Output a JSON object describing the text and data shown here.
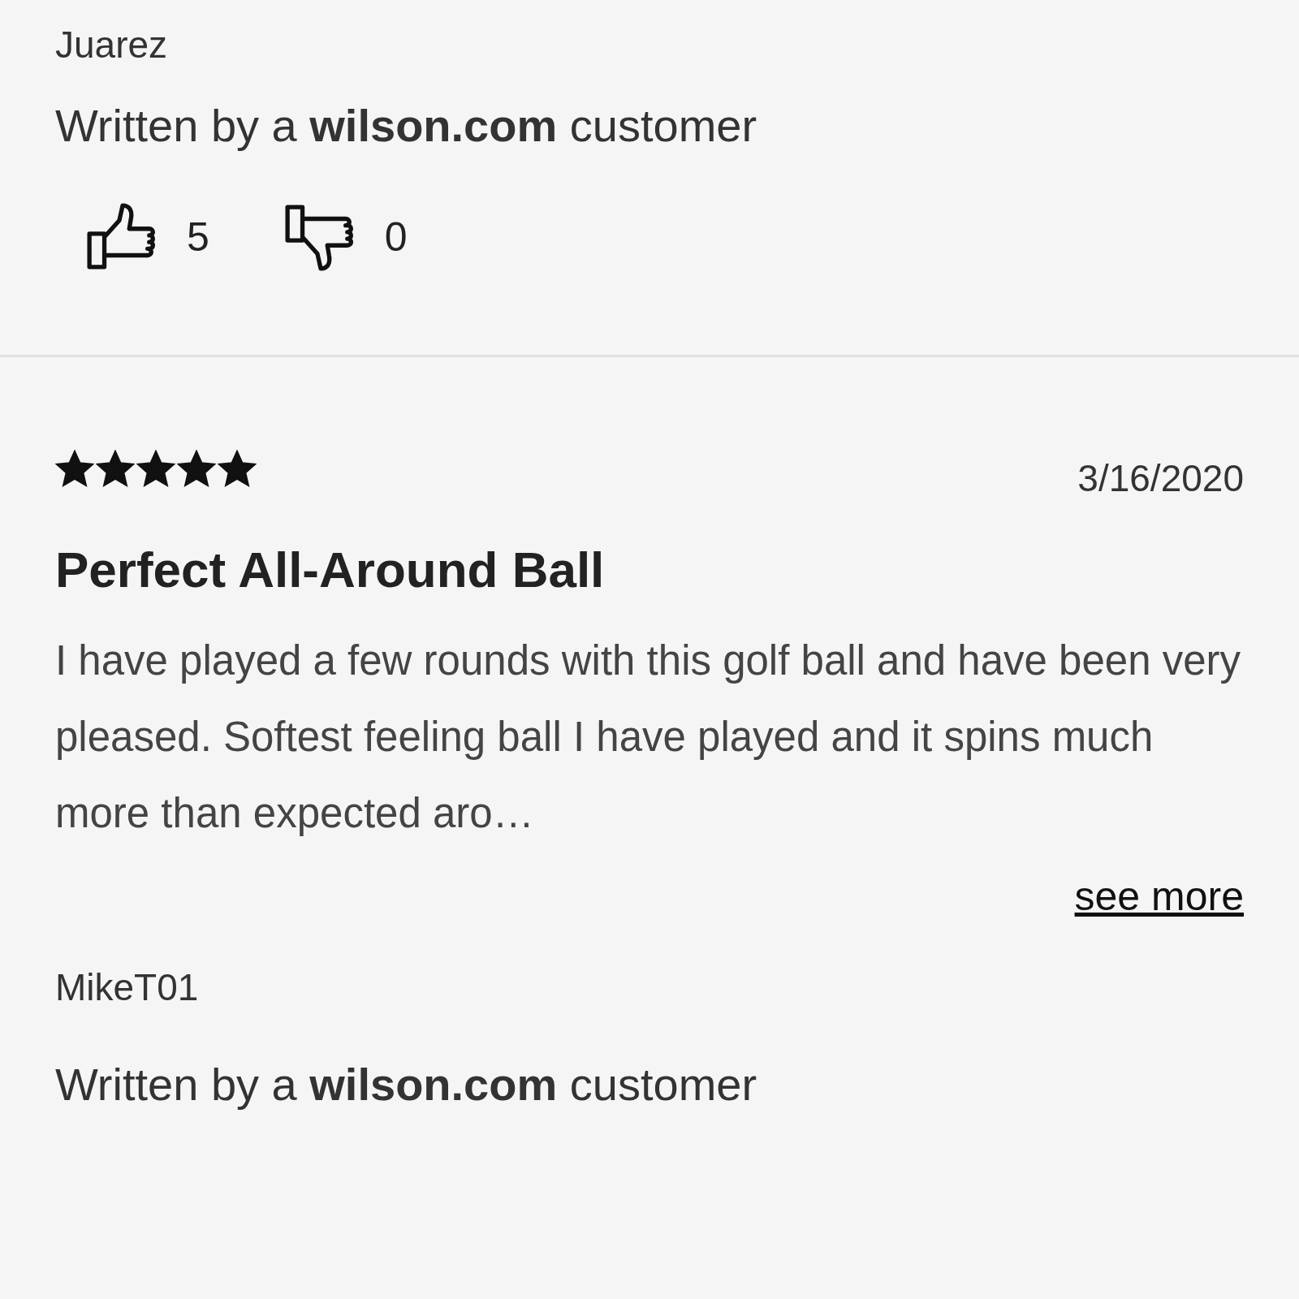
{
  "reviews": [
    {
      "author": "Juarez",
      "attribution": "Written by a **wilson.com** customer",
      "votes": [
        {
          "kind": "up",
          "count": "5"
        },
        {
          "kind": "down",
          "count": "0"
        }
      ]
    },
    {
      "stars": 5,
      "date": "3/16/2020",
      "title": "Perfect All-Around Ball",
      "body": "I have played a few rounds with this golf ball and have been very pleased. Softest feeling ball I have played and it spins much more than expected aro…",
      "see_more": "see more",
      "author": "MikeT01",
      "attribution": "Written by a **wilson.com** customer"
    }
  ]
}
